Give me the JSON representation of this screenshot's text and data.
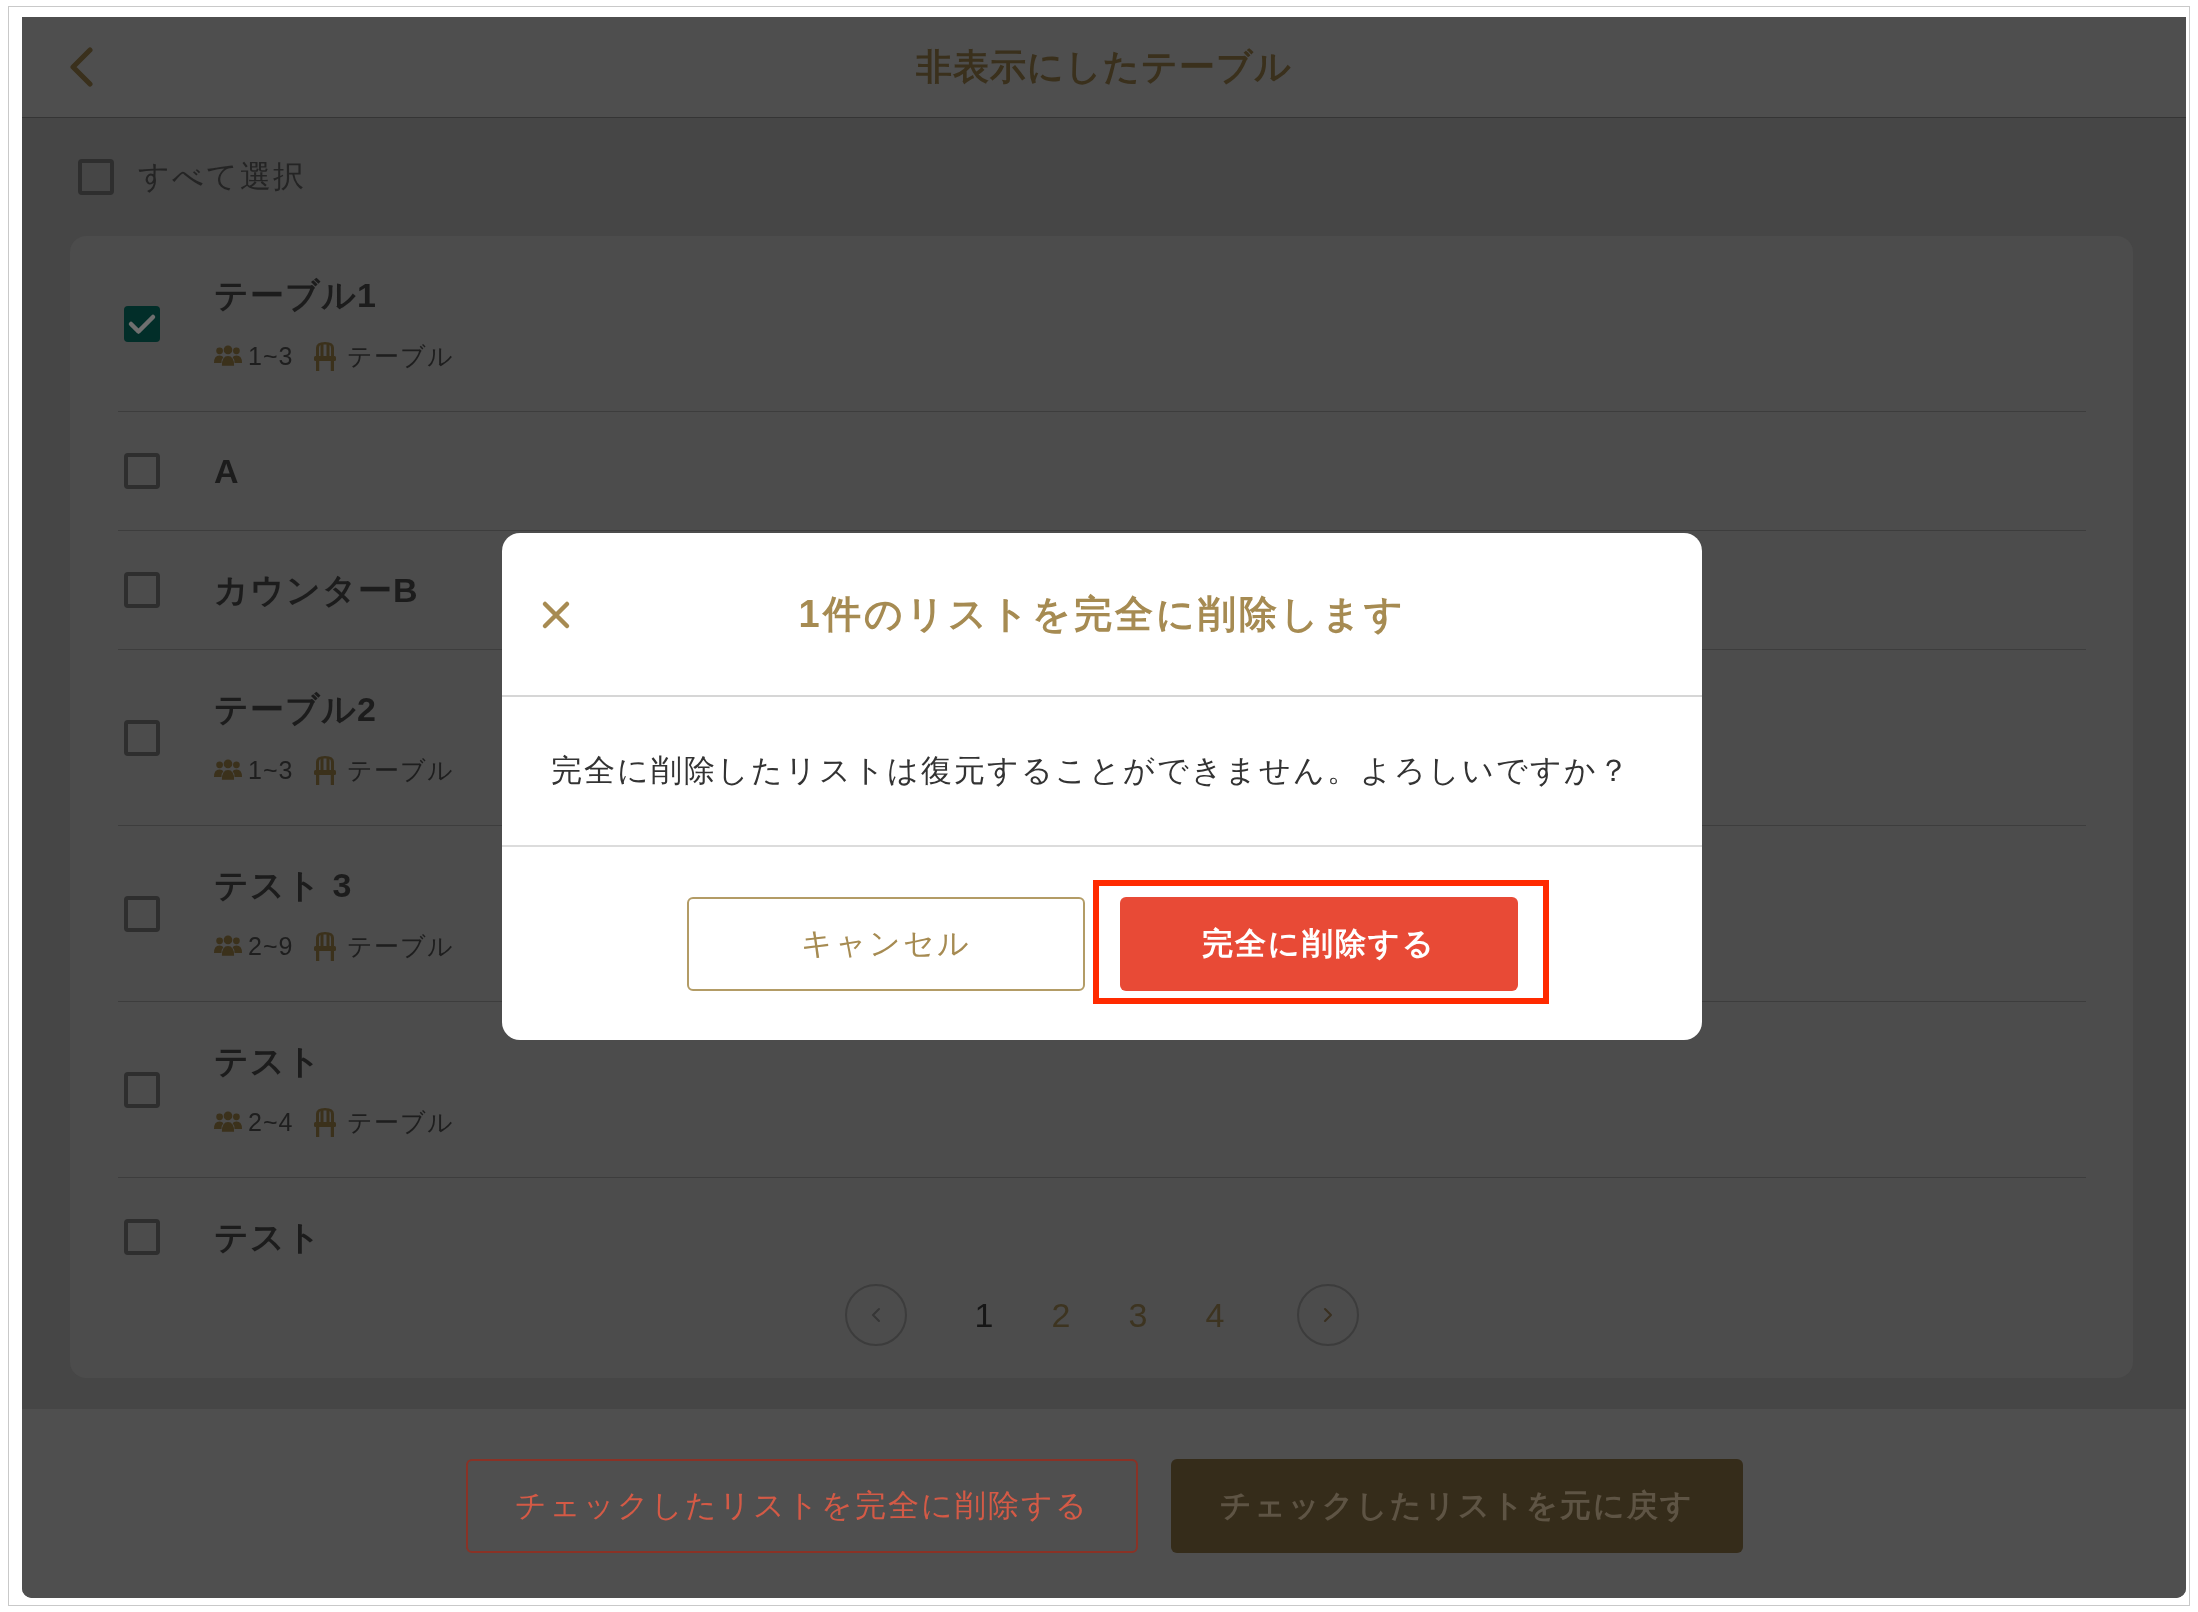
{
  "header": {
    "title": "非表示にしたテーブル"
  },
  "select_all": {
    "label": "すべて選択",
    "checked": false
  },
  "tables": [
    {
      "name": "テーブル1",
      "checked": true,
      "capacity": "1~3",
      "type": "テーブル"
    },
    {
      "name": "A",
      "checked": false
    },
    {
      "name": "カウンターB",
      "checked": false
    },
    {
      "name": "テーブル2",
      "checked": false,
      "capacity": "1~3",
      "type": "テーブル"
    },
    {
      "name": "テスト 3",
      "checked": false,
      "capacity": "2~9",
      "type": "テーブル"
    },
    {
      "name": "テスト",
      "checked": false,
      "capacity": "2~4",
      "type": "テーブル"
    },
    {
      "name": "テスト",
      "checked": false
    }
  ],
  "pagination": {
    "pages": [
      {
        "label": "1",
        "selected": true
      },
      {
        "label": "2",
        "selected": false
      },
      {
        "label": "3",
        "selected": false
      },
      {
        "label": "4",
        "selected": false
      }
    ]
  },
  "footer": {
    "buttons": [
      {
        "label": "チェックしたリストを完全に削除する",
        "kind": "outline"
      },
      {
        "label": "チェックしたリストを元に戻す",
        "kind": "filled"
      }
    ]
  },
  "dialog": {
    "title": "1件のリストを完全に削除します",
    "message": "完全に削除したリストは復元することができません。よろしいですか？",
    "buttons": [
      {
        "label": "キャンセル",
        "kind": "outline",
        "highlighted": false
      },
      {
        "label": "完全に削除する",
        "kind": "danger",
        "highlighted": true
      }
    ]
  }
}
